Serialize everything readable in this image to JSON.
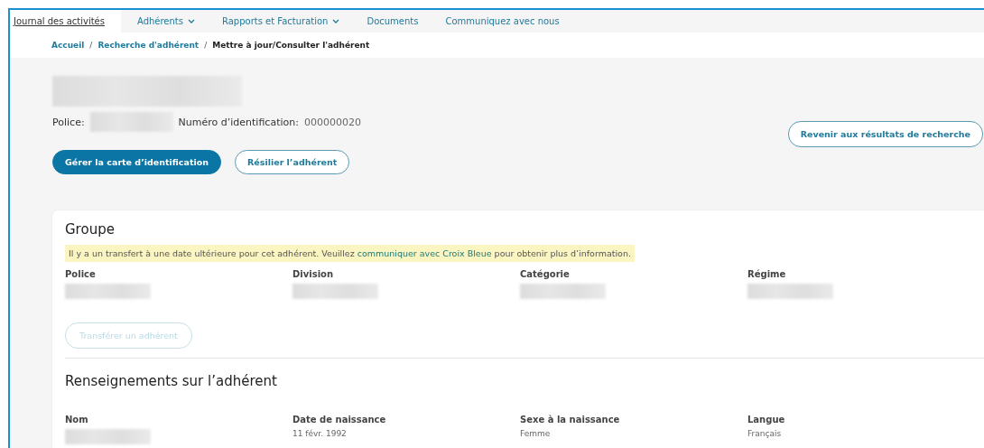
{
  "nav": {
    "items": [
      {
        "label": "Journal des activités",
        "kind": "link",
        "selected": true
      },
      {
        "label": "Adhérents",
        "kind": "menu",
        "selected": false
      },
      {
        "label": "Rapports et Facturation",
        "kind": "menu",
        "selected": false
      },
      {
        "label": "Documents",
        "kind": "link",
        "selected": false
      },
      {
        "label": "Communiquez avec nous",
        "kind": "link",
        "selected": false
      }
    ]
  },
  "breadcrumb_separator": "/",
  "breadcrumb": [
    {
      "label": "Accueil",
      "kind": "link"
    },
    {
      "label": "Recherche d'adhérent",
      "kind": "link"
    },
    {
      "label": "Mettre à jour/Consulter l'adhérent",
      "kind": "current"
    }
  ],
  "header": {
    "police_label": "Police:",
    "id_label": "Numéro d’identification:",
    "id_value": "000000020",
    "back_button": "Revenir aux résultats de recherche",
    "buttons": [
      {
        "label": "Gérer la carte d’identification",
        "kind": "primary"
      },
      {
        "label": "Résilier l’adhérent",
        "kind": "outline"
      }
    ]
  },
  "group": {
    "title": "Groupe",
    "notice": {
      "text": "Il y a un transfert à une date ultérieure pour cet adhérent. Veuillez ",
      "link": "communiquer avec Croix Bleue",
      "after": " pour obtenir plus d’information."
    },
    "fields": [
      {
        "label": "Police"
      },
      {
        "label": "Division"
      },
      {
        "label": "Catégorie"
      },
      {
        "label": "Régime"
      }
    ],
    "transfer_button": {
      "label": "Transférer un adhérent",
      "disabled": true
    }
  },
  "member": {
    "title": "Renseignements sur l’adhérent",
    "fields": [
      {
        "label": "Nom"
      },
      {
        "label": "Date de naissance",
        "value": "11 févr. 1992"
      },
      {
        "label": "Sexe à la naissance",
        "value": "Femme"
      },
      {
        "label": "Langue",
        "value": "Français"
      }
    ]
  }
}
